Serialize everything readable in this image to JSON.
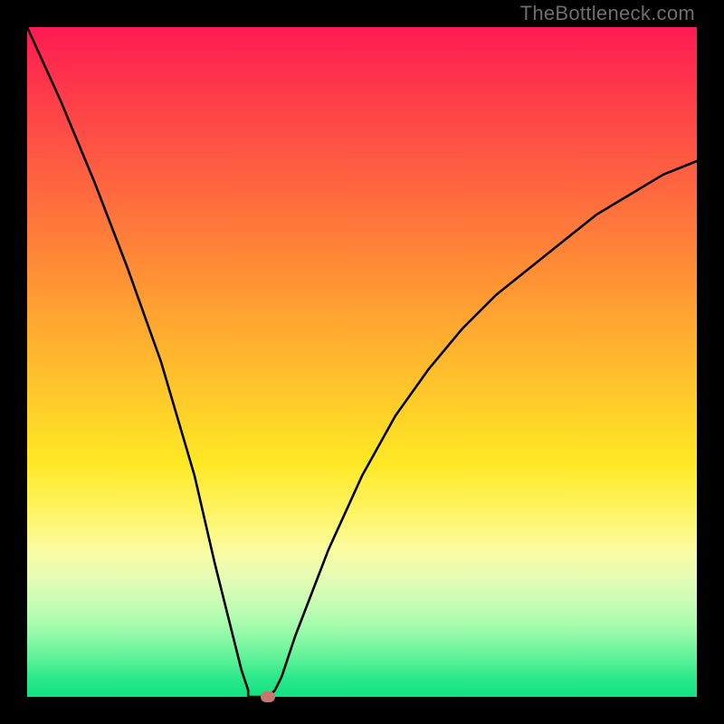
{
  "watermark": "TheBottleneck.com",
  "chart_data": {
    "type": "line",
    "title": "",
    "xlabel": "",
    "ylabel": "",
    "xlim": [
      0,
      100
    ],
    "ylim": [
      0,
      100
    ],
    "grid": false,
    "legend": false,
    "series": [
      {
        "name": "bottleneck-curve",
        "x": [
          0,
          5,
          10,
          15,
          20,
          25,
          28,
          30,
          32,
          33,
          34,
          35,
          36,
          37,
          38,
          40,
          45,
          50,
          55,
          60,
          65,
          70,
          75,
          80,
          85,
          90,
          95,
          100
        ],
        "y": [
          100,
          89,
          77,
          64,
          50,
          33,
          20,
          12,
          4,
          1,
          0,
          0,
          0,
          1,
          3,
          9,
          22,
          33,
          42,
          49,
          55,
          60,
          64,
          68,
          72,
          75,
          78,
          80
        ]
      }
    ],
    "plateau": {
      "x_start": 33,
      "x_end": 36,
      "y": 0
    },
    "marker": {
      "x": 36,
      "y": 0,
      "color": "#c6766c"
    }
  },
  "colors": {
    "curve": "#000000",
    "marker": "#c6766c",
    "frame": "#000000"
  }
}
